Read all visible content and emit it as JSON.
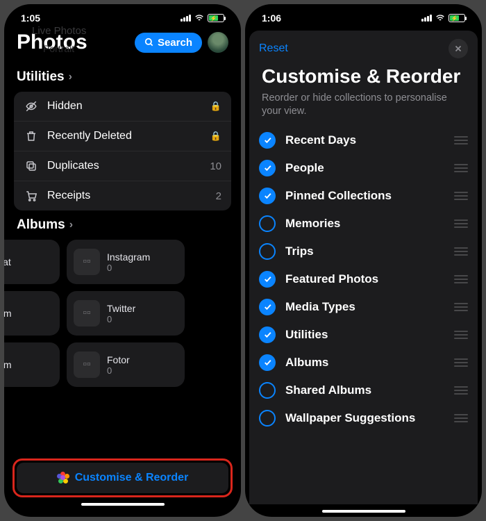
{
  "left": {
    "time": "1:05",
    "title": "Photos",
    "ghost1": "Live Photos",
    "ghost2": "Portrait",
    "search_label": "Search",
    "utilities": {
      "heading": "Utilities",
      "items": [
        {
          "label": "Hidden",
          "meta": "lock"
        },
        {
          "label": "Recently Deleted",
          "meta": "lock"
        },
        {
          "label": "Duplicates",
          "meta": "10"
        },
        {
          "label": "Receipts",
          "meta": "2"
        }
      ]
    },
    "albums": {
      "heading": "Albums",
      "col1": [
        {
          "label": "napchat",
          "count": ""
        },
        {
          "label": "stagram",
          "count": ""
        },
        {
          "label": "stagram",
          "count": ""
        }
      ],
      "col2": [
        {
          "label": "Instagram",
          "count": "0"
        },
        {
          "label": "Twitter",
          "count": "0"
        },
        {
          "label": "Fotor",
          "count": "0"
        }
      ]
    },
    "customise_label": "Customise & Reorder"
  },
  "right": {
    "time": "1:06",
    "reset_label": "Reset",
    "title": "Customise & Reorder",
    "subtitle": "Reorder or hide collections to personalise your view.",
    "options": [
      {
        "label": "Recent Days",
        "checked": true
      },
      {
        "label": "People",
        "checked": true
      },
      {
        "label": "Pinned Collections",
        "checked": true
      },
      {
        "label": "Memories",
        "checked": false
      },
      {
        "label": "Trips",
        "checked": false
      },
      {
        "label": "Featured Photos",
        "checked": true
      },
      {
        "label": "Media Types",
        "checked": true
      },
      {
        "label": "Utilities",
        "checked": true
      },
      {
        "label": "Albums",
        "checked": true
      },
      {
        "label": "Shared Albums",
        "checked": false
      },
      {
        "label": "Wallpaper Suggestions",
        "checked": false
      }
    ]
  }
}
